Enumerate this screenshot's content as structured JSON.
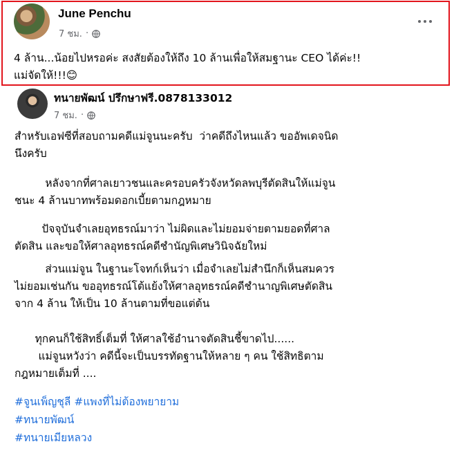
{
  "post1": {
    "author": "June Penchu",
    "time": "7 ชม.",
    "separator": "·",
    "text": "4 ล้าน...น้อยไปหรอค่ะ สงสัยต้องให้ถึง 10 ล้านเพื่อให้สมฐานะ CEO ได้ค่ะ!!\nแม่จัดให้!!!😊"
  },
  "post2": {
    "author": "ทนายพัฒน์ ปรึกษาฟรี.0878133012",
    "time": "7 ชม.",
    "separator": "·",
    "paragraphs": [
      "สำหรับเอฟซีที่สอบถามคดีแม่จูนนะครับ  ว่าคดีถึงไหนแล้ว ขออัพเดจนิด\nนึงครับ",
      "         หลังจากที่ศาลเยาวชนและครอบครัวจังหวัดลพบุรีตัดสินให้แม่จูน\nชนะ 4 ล้านบาทพร้อมดอกเบี้ยตามกฎหมาย",
      "        ปัจจุบันจำเลยอุทธรณ์มาว่า ไม่ผิดและไม่ยอมจ่ายตามยอดที่ศาล\nตัดสิน และขอให้ศาลอุทธรณ์คดีชำนัญพิเศษวินิจฉัยใหม่",
      "         ส่วนแม่จูน ในฐานะโจทก์เห็นว่า เมื่อจำเลยไม่สำนึกก็เห็นสมควร\nไม่ยอมเช่นกัน ขออุทธรณ์โต้แย้งให้ศาลอุทธรณ์คดีชำนาญพิเศษตัดสิน\nจาก 4 ล้าน ให้เป็น 10 ล้านตามที่ขอแต่ต้น",
      "      ทุกคนก็ใช้สิทธิ์เต็มที่ ให้ศาลใช้อำนาจตัดสินชี้ขาดไป......\n       แม่จูนหวังว่า คดีนี้จะเป็นบรรทัดฐานให้หลาย ๆ คน ใช้สิทธิตาม\nกฎหมายเต็มที่ ...."
    ],
    "hashtags": [
      "#จูนเพ็ญชุลี #แพงที่ไม่ต้องพยายาม",
      "#ทนายพัฒน์",
      "#ทนายเมียหลวง"
    ]
  },
  "colors": {
    "highlight_border": "#e2141c",
    "hashtag": "#216fdb",
    "meta": "#65676b"
  },
  "icons": [
    "globe-icon",
    "more-options-icon"
  ]
}
